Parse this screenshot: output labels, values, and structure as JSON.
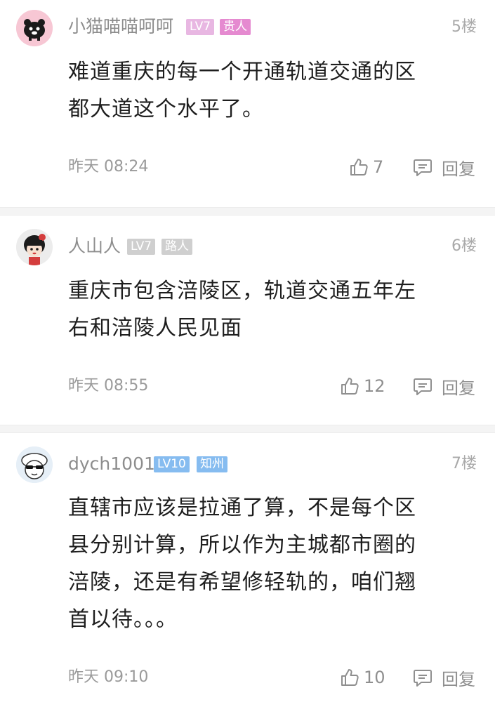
{
  "comments": [
    {
      "username": "小猫喵喵呵呵",
      "level": "LV7",
      "title": "贵人",
      "floor": "5楼",
      "lines": [
        "难道重庆的每一个开通轨道交通的区",
        "都大道这个水平了。"
      ],
      "time": "昨天 08:24",
      "likes": "7",
      "reply": "回复",
      "level_color": "#e8b7e2",
      "title_color": "#e58ad0"
    },
    {
      "username": "人山人",
      "level": "LV7",
      "title": "路人",
      "floor": "6楼",
      "lines": [
        "重庆市包含涪陵区，轨道交通五年左",
        "右和涪陵人民见面"
      ],
      "time": "昨天 08:55",
      "likes": "12",
      "reply": "回复",
      "level_color": "#cfcfcf",
      "title_color": "#cfcfcf"
    },
    {
      "username": "dych1001",
      "level": "LV10",
      "title": "知州",
      "floor": "7楼",
      "lines": [
        "直辖市应该是拉通了算，不是每个区",
        "县分别计算，所以作为主城都市圈的",
        "涪陵，还是有希望修轻轨的，咱们翘",
        "首以待。。。"
      ],
      "time": "昨天 09:10",
      "likes": "10",
      "reply": "回复",
      "level_color": "#86bcf0",
      "title_color": "#86bcf0"
    }
  ]
}
